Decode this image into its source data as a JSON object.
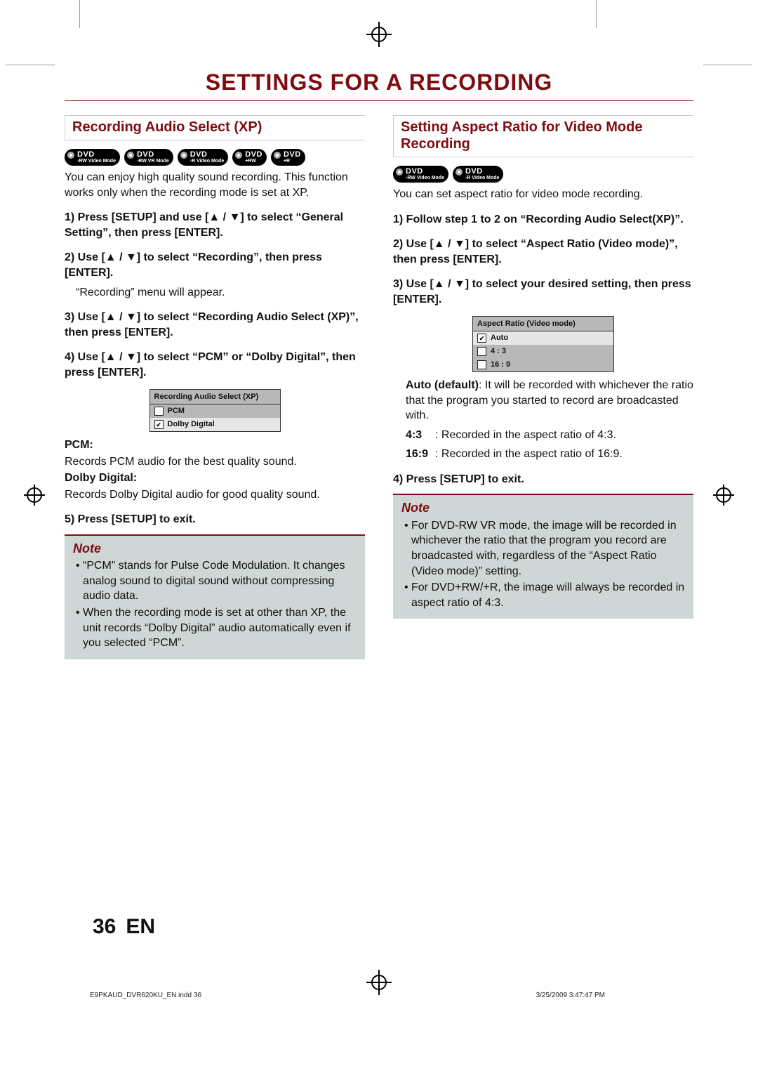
{
  "page_title": "SETTINGS FOR A RECORDING",
  "left": {
    "heading": "Recording Audio Select (XP)",
    "badges": [
      {
        "top": "DVD",
        "bot": "-RW Video Mode"
      },
      {
        "top": "DVD",
        "bot": "-RW VR Mode"
      },
      {
        "top": "DVD",
        "bot": "-R Video Mode"
      },
      {
        "top": "DVD",
        "bot": "+RW"
      },
      {
        "top": "DVD",
        "bot": "+R"
      }
    ],
    "intro": "You can enjoy high quality sound recording. This function works only when the recording mode is set at XP.",
    "step1": "1) Press [SETUP] and use [▲ / ▼] to select “General Setting”, then press [ENTER].",
    "step2": "2) Use [▲ / ▼] to select “Recording”, then press [ENTER].",
    "step2_sub": "“Recording” menu will appear.",
    "step3": "3) Use [▲ / ▼] to select “Recording Audio Select (XP)”, then press [ENTER].",
    "step4": "4) Use [▲ / ▼] to select “PCM” or “Dolby Digital”, then press [ENTER].",
    "menu": {
      "title": "Recording Audio Select (XP)",
      "opt1": "PCM",
      "opt2": "Dolby Digital"
    },
    "pcm_h": "PCM:",
    "pcm_d": "Records PCM audio for the best quality sound.",
    "dd_h": "Dolby Digital:",
    "dd_d": "Records Dolby Digital audio for good quality sound.",
    "step5": "5) Press [SETUP] to exit.",
    "note_title": "Note",
    "note_items": [
      "“PCM” stands for Pulse Code Modulation. It changes analog sound to digital sound without compressing audio data.",
      "When the recording mode is set at other than XP, the unit records “Dolby Digital” audio automatically even if you selected “PCM”."
    ]
  },
  "right": {
    "heading": "Setting Aspect Ratio for Video Mode Recording",
    "badges": [
      {
        "top": "DVD",
        "bot": "-RW Video Mode"
      },
      {
        "top": "DVD",
        "bot": "-R Video Mode"
      }
    ],
    "intro": "You can set aspect ratio for video mode recording.",
    "step1": "1) Follow step 1 to 2 on “Recording Audio Select(XP)”.",
    "step2": "2) Use [▲ / ▼] to select “Aspect Ratio (Video mode)”, then press [ENTER].",
    "step3": "3) Use [▲ / ▼] to select your desired setting, then press [ENTER].",
    "menu": {
      "title": "Aspect Ratio (Video mode)",
      "opt1": "Auto",
      "opt2": "4 : 3",
      "opt3": "16 : 9"
    },
    "auto_b": "Auto (default)",
    "auto_d": ": It will be recorded with whichever the ratio that the program you started to record are broadcasted with.",
    "r43_b": "4:3",
    "r43_d": ":   Recorded in the aspect ratio of 4:3.",
    "r169_b": "16:9",
    "r169_d": ":  Recorded in the aspect ratio of 16:9.",
    "step4": "4) Press [SETUP] to exit.",
    "note_title": "Note",
    "note_items": [
      "For DVD-RW VR mode, the image will be recorded in whichever the ratio that the program you record are broadcasted with, regardless of the “Aspect Ratio (Video mode)” setting.",
      "For DVD+RW/+R, the image will always be recorded in aspect ratio of 4:3."
    ]
  },
  "footer": {
    "page_no": "36",
    "lang": "EN"
  },
  "meta": {
    "file": "E9PKAUD_DVR620KU_EN.indd   36",
    "stamp": "3/25/2009   3:47:47 PM"
  }
}
